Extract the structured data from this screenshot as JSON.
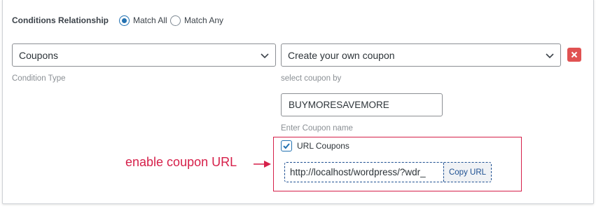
{
  "conditions": {
    "relationship_label": "Conditions Relationship",
    "options": [
      {
        "label": "Match All",
        "selected": true
      },
      {
        "label": "Match Any",
        "selected": false
      }
    ]
  },
  "condition_row": {
    "type_value": "Coupons",
    "type_help": "Condition Type",
    "coupon_by_value": "Create your own coupon",
    "coupon_by_help": "select coupon by",
    "coupon_name_value": "BUYMORESAVEMORE",
    "coupon_name_help": "Enter Coupon name",
    "url_coupons": {
      "label": "URL Coupons",
      "checked": true,
      "url_value": "http://localhost/wordpress/?wdr_",
      "copy_label": "Copy URL"
    }
  },
  "annotation": {
    "text": "enable coupon URL"
  },
  "colors": {
    "accent": "#2271b1",
    "danger": "#e05252",
    "annotation": "#d6204a",
    "copy_button_text": "#1d4f91"
  },
  "icons": {
    "select_arrow": "chevron-down-icon",
    "remove": "close-icon",
    "checkbox": "checkmark-icon",
    "pointer": "arrow-right-icon"
  }
}
